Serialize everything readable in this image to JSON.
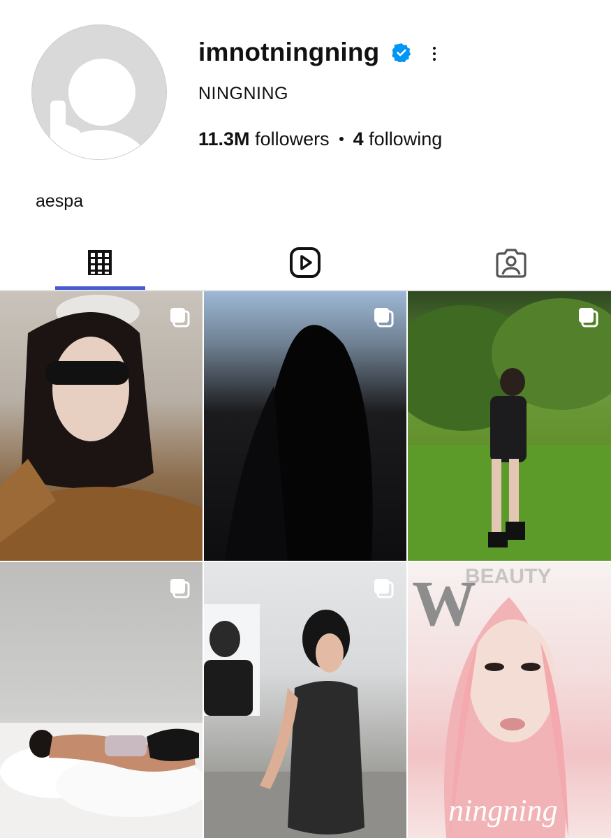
{
  "profile": {
    "username": "imnotningning",
    "full_name": "NINGNING",
    "followers_count": "11.3M",
    "followers_label": "followers",
    "following_count": "4",
    "following_label": "following",
    "bio": "aespa",
    "verified": true
  },
  "tabs": [
    {
      "icon": "grid-icon",
      "selected": true
    },
    {
      "icon": "reels-icon",
      "selected": false
    },
    {
      "icon": "tagged-icon",
      "selected": false
    }
  ],
  "colors": {
    "verified_blue": "#0095f6",
    "tab_indicator": "#4a5ad0",
    "text": "#111111"
  },
  "posts": [
    {
      "multi": true
    },
    {
      "multi": true
    },
    {
      "multi": true
    },
    {
      "multi": true
    },
    {
      "multi": true
    },
    {
      "multi": false,
      "overlay_text": "W",
      "overlay_text_2": "BEAUTY",
      "caption_script": "ningning"
    }
  ]
}
